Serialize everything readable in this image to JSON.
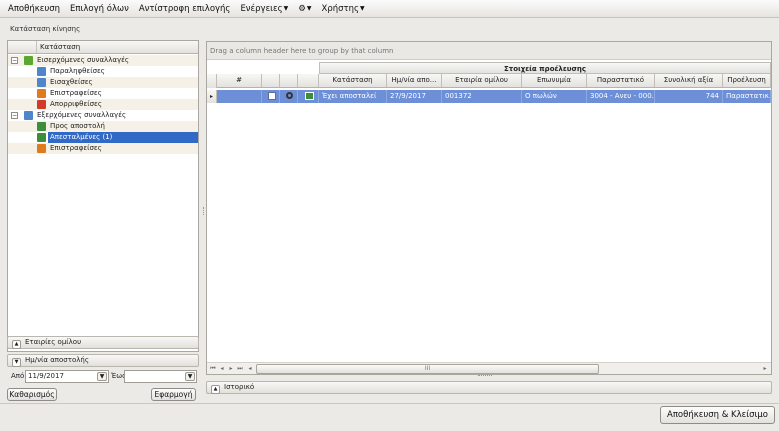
{
  "menubar": {
    "items": [
      {
        "label": "Αποθήκευση",
        "has_dropdown": false
      },
      {
        "label": "Επιλογή όλων",
        "has_dropdown": false
      },
      {
        "label": "Αντίστροφη επιλογής",
        "has_dropdown": false
      },
      {
        "label": "Ενέργειες",
        "has_dropdown": true
      },
      {
        "label": "⚙",
        "has_dropdown": true,
        "icon": "gear-icon"
      },
      {
        "label": "Χρήστης",
        "has_dropdown": true
      }
    ]
  },
  "left_panel": {
    "title": "Κατάσταση κίνησης",
    "tree_header": "Κατάσταση",
    "tree": [
      {
        "label": "Εισερχόμενες συναλλαγές",
        "level": 0,
        "expander": "−",
        "icon": "incoming-icon",
        "icon_color": "#5aa832",
        "selected": false,
        "alt": true
      },
      {
        "label": "Παραληφθείσες",
        "level": 1,
        "icon": "received-icon",
        "icon_color": "#4f86c9",
        "selected": false,
        "alt": false
      },
      {
        "label": "Εισαχθείσες",
        "level": 1,
        "icon": "imported-icon",
        "icon_color": "#4f86c9",
        "selected": false,
        "alt": true
      },
      {
        "label": "Επιστραφείσες",
        "level": 1,
        "icon": "returned-icon",
        "icon_color": "#e07a1e",
        "selected": false,
        "alt": false
      },
      {
        "label": "Απορριφθείσες",
        "level": 1,
        "icon": "rejected-icon",
        "icon_color": "#d23b2a",
        "selected": false,
        "alt": true
      },
      {
        "label": "Εξερχόμενες συναλλαγές",
        "level": 0,
        "expander": "−",
        "icon": "outgoing-icon",
        "icon_color": "#4f86c9",
        "selected": false,
        "alt": false
      },
      {
        "label": "Προς αποστολή",
        "level": 1,
        "icon": "to-send-icon",
        "icon_color": "#3d8d3a",
        "selected": false,
        "alt": true
      },
      {
        "label": "Απεσταλμένες (1)",
        "level": 1,
        "icon": "sent-icon",
        "icon_color": "#3d8d3a",
        "selected": true,
        "alt": false
      },
      {
        "label": "Επιστραφείσες",
        "level": 1,
        "icon": "returned-icon",
        "icon_color": "#e07a1e",
        "selected": false,
        "alt": true
      }
    ],
    "group_companies_label": "Εταιρίες ομίλου",
    "send_date_label": "Ημ/νία αποστολής",
    "from_label": "Από",
    "from_value": "11/9/2017",
    "to_label": "Έως",
    "to_value": "",
    "clear_label": "Καθαρισμός",
    "apply_label": "Εφαρμογή"
  },
  "grid": {
    "group_hint": "Drag a column header here to group by that column",
    "band_label": "Στοιχεία προέλευσης",
    "columns": [
      {
        "key": "num",
        "label": "#"
      },
      {
        "key": "check",
        "label": ""
      },
      {
        "key": "view",
        "label": ""
      },
      {
        "key": "icon",
        "label": ""
      },
      {
        "key": "status",
        "label": "Κατάσταση"
      },
      {
        "key": "date",
        "label": "Ημ/νία απο..."
      },
      {
        "key": "company",
        "label": "Εταιρία ομίλου"
      },
      {
        "key": "name",
        "label": "Επωνυμία"
      },
      {
        "key": "doc",
        "label": "Παραστατικό"
      },
      {
        "key": "total",
        "label": "Συνολική αξία"
      },
      {
        "key": "origin",
        "label": "Προέλευση"
      }
    ],
    "rows": [
      {
        "status": "Έχει αποσταλεί",
        "date": "27/9/2017",
        "company": "001372",
        "name": "Ο πωλών",
        "doc": "3004 - Ανευ - 000...",
        "total": "744",
        "origin": "Παραστατικ..."
      }
    ],
    "scroll_thumb": "III"
  },
  "history_label": "Ιστορικό",
  "save_close_label": "Αποθήκευση & Κλείσιμο"
}
